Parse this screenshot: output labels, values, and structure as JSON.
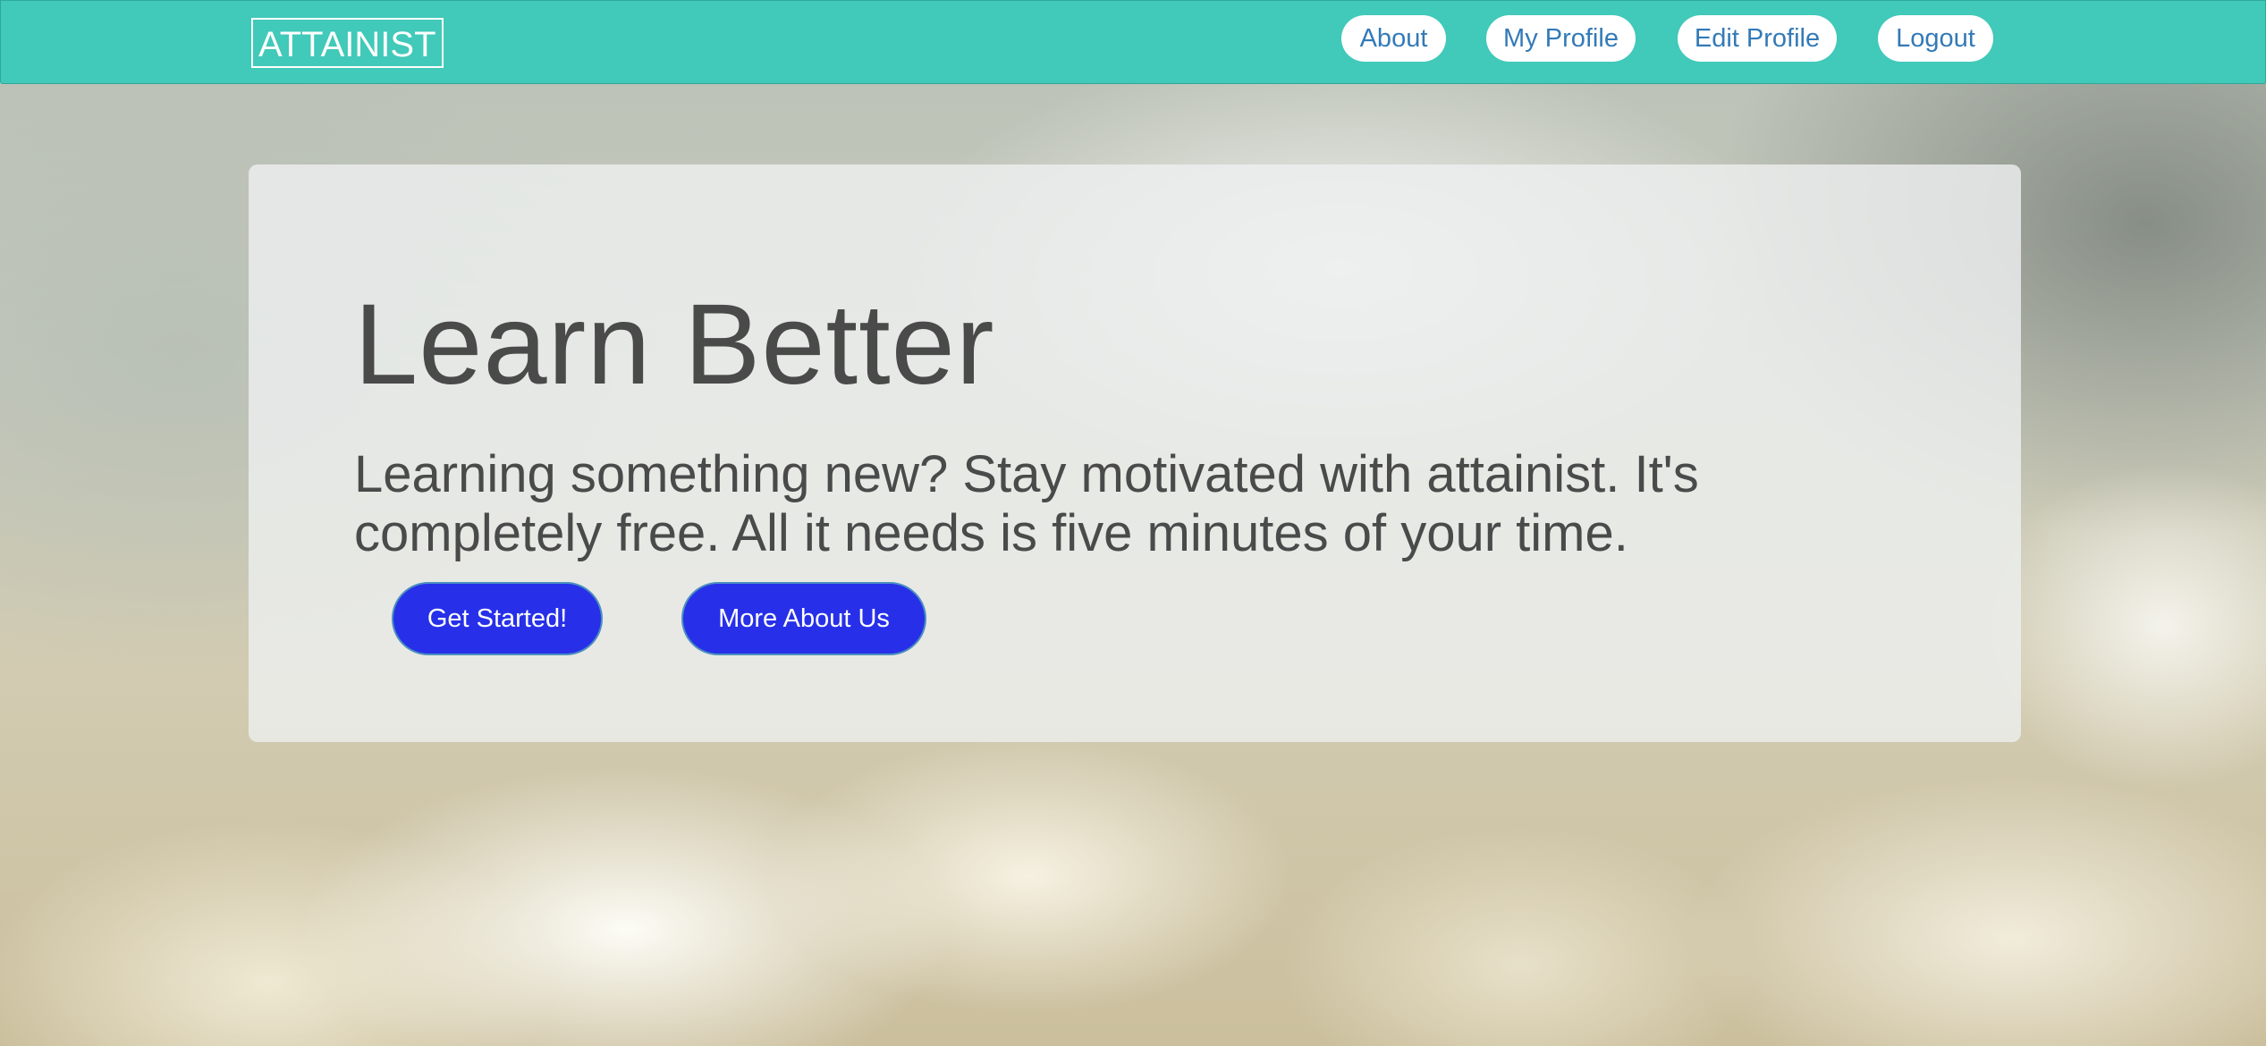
{
  "navbar": {
    "brand": "ATTAINIST",
    "links": [
      {
        "label": "About"
      },
      {
        "label": "My Profile"
      },
      {
        "label": "Edit Profile"
      },
      {
        "label": "Logout"
      }
    ],
    "background_color": "#41c9b9",
    "link_color": "#337ab7"
  },
  "hero": {
    "title": "Learn Better",
    "subtitle": "Learning something new? Stay motivated with attainist. It's completely free. All it needs is five minutes of your time.",
    "buttons": [
      {
        "label": "Get Started!"
      },
      {
        "label": "More About Us"
      }
    ],
    "button_color": "#2730e8"
  },
  "background": {
    "description_icon": "cloudy-sky"
  }
}
